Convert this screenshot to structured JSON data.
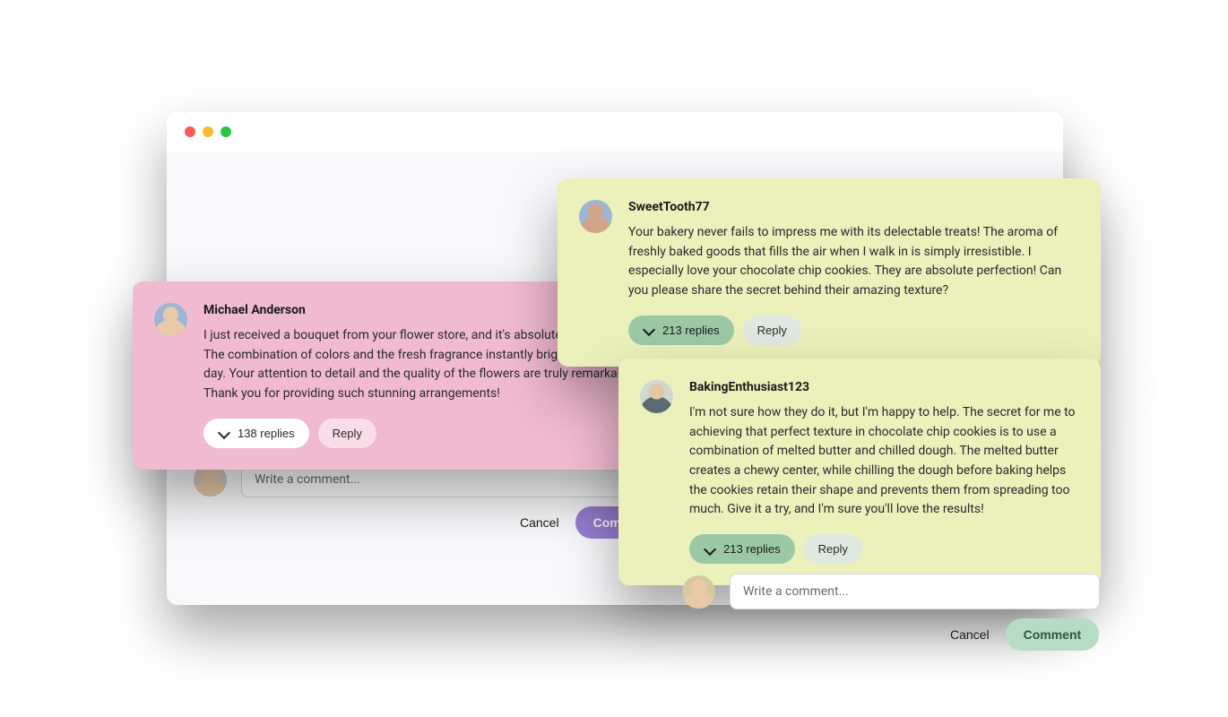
{
  "window": {
    "dots": [
      "red",
      "yellow",
      "green"
    ]
  },
  "cards": [
    {
      "username": "Michael Anderson",
      "body": "I just received a bouquet from your flower store, and it's absolutely breathtaking! The combination of colors and the fresh fragrance instantly brightened up my day. Your attention to detail and the quality of the flowers are truly remarkable. Thank you for providing such stunning arrangements!",
      "replies_label": "138 replies",
      "reply_label": "Reply"
    },
    {
      "username": "SweetTooth77",
      "body": "Your bakery never fails to impress me with its delectable treats! The aroma of freshly baked goods that fills the air when I walk in is simply irresistible. I especially love your chocolate chip cookies. They are absolute perfection! Can you please share the secret behind their amazing texture?",
      "replies_label": "213 replies",
      "reply_label": "Reply"
    },
    {
      "username": "BakingEnthusiast123",
      "body": "I'm not sure how they do it, but I'm happy to help. The secret for me to achieving that perfect texture in chocolate chip cookies is to use a combination of melted butter and chilled dough. The melted butter creates a chewy center, while chilling the dough before baking helps the cookies retain their shape and prevents them from spreading too much. Give it a try, and I'm sure you'll love the results!",
      "replies_label": "213 replies",
      "reply_label": "Reply"
    }
  ],
  "composer": {
    "placeholder": "Write a comment...",
    "cancel_label": "Cancel",
    "submit_label": "Comment"
  }
}
